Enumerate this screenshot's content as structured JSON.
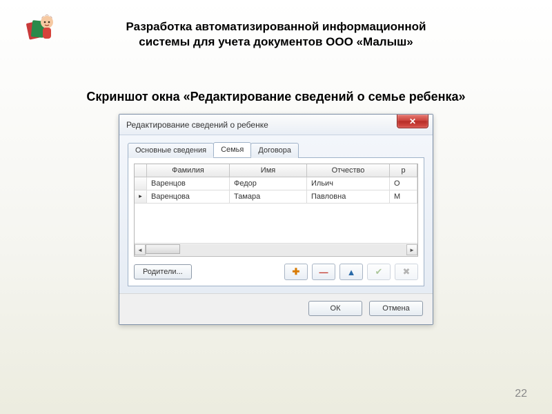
{
  "slide": {
    "header_line1": "Разработка автоматизированной информационной",
    "header_line2": "системы для учета документов ООО «Малыш»",
    "caption": "Скриншот окна «Редактирование сведений о семье ребенка»",
    "page_number": "22"
  },
  "dialog": {
    "title": "Редактирование сведений о ребенке",
    "close_glyph": "✕",
    "tabs": [
      {
        "label": "Основные сведения",
        "active": false
      },
      {
        "label": "Семья",
        "active": true
      },
      {
        "label": "Договора",
        "active": false
      }
    ],
    "grid": {
      "headers": {
        "fam": "Фамилия",
        "name": "Имя",
        "pat": "Отчество",
        "rest": "р"
      },
      "rows": [
        {
          "marker": "",
          "fam": "Варенцов",
          "name": "Федор",
          "pat": "Ильич",
          "rest": "О"
        },
        {
          "marker": "▸",
          "fam": "Варенцова",
          "name": "Тамара",
          "pat": "Павловна",
          "rest": "М"
        }
      ]
    },
    "parents_btn": "Родители...",
    "toolbar": {
      "add": "✚",
      "remove": "—",
      "edit": "▲",
      "post": "✔",
      "cancel": "✖"
    },
    "footer": {
      "ok": "ОК",
      "cancel": "Отмена"
    }
  }
}
